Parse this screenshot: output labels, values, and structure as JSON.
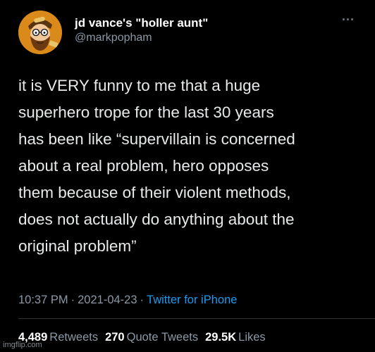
{
  "author": {
    "display_name": "jd vance's \"holler aunt\"",
    "handle": "@markpopham",
    "avatar_icon": "cartoon-bearded-man-avatar"
  },
  "more_icon": "more-options-dots",
  "tweet": {
    "lines": [
      "it is VERY funny to me that a huge",
      "superhero trope for the last 30 years",
      "has been like “supervillain is concerned",
      "about a real problem, hero opposes",
      "them because of their violent methods,",
      "does not actually do anything about the",
      "original problem”"
    ]
  },
  "meta": {
    "time": "10:37 PM",
    "separator": "·",
    "date": "2021-04-23",
    "source": "Twitter for iPhone"
  },
  "stats": {
    "retweets_count": "4,489",
    "retweets_label": "Retweets",
    "quotes_count": "270",
    "quotes_label": "Quote Tweets",
    "likes_count": "29.5K",
    "likes_label": "Likes"
  },
  "watermark": "imgflip.com",
  "colors": {
    "background": "#000000",
    "text": "#e7e9ea",
    "secondary": "#8b98a5",
    "link": "#1d9bf0"
  }
}
